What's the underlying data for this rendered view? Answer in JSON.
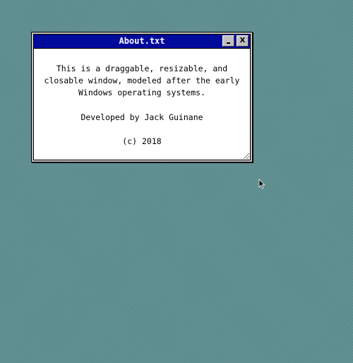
{
  "window": {
    "title": "About.txt",
    "minimize_label": "",
    "close_label": "X",
    "content": {
      "line1": "This is a draggable, resizable, and",
      "line2": "closable window, modeled after the early",
      "line3": "Windows operating systems.",
      "developer": "Developed by Jack Guinane",
      "copyright": "(c) 2018"
    }
  },
  "colors": {
    "desktop": "#5f8f91",
    "titlebar": "#000a9b",
    "window_frame": "#c0c0c0"
  },
  "icons": {
    "cursor": "mouse-pointer-icon",
    "resize": "resize-grip-icon"
  }
}
